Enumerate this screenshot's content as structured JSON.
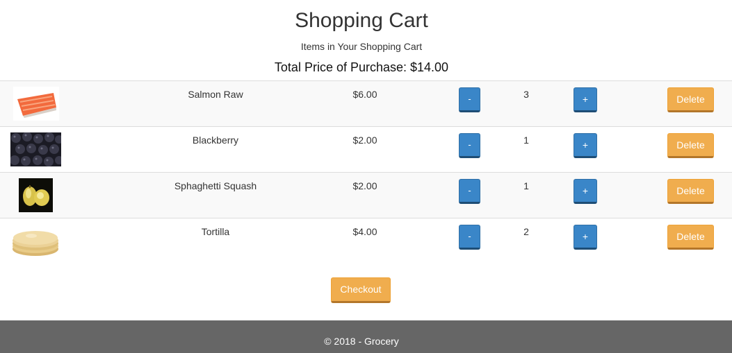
{
  "header": {
    "title": "Shopping Cart",
    "subtitle": "Items in Your Shopping Cart",
    "total_label": "Total Price of Purchase: $14.00"
  },
  "cart": {
    "minus_label": "-",
    "plus_label": "+",
    "delete_label": "Delete",
    "items": [
      {
        "name": "Salmon Raw",
        "price": "$6.00",
        "quantity": "3",
        "image": "salmon-image"
      },
      {
        "name": "Blackberry",
        "price": "$2.00",
        "quantity": "1",
        "image": "blackberry-image"
      },
      {
        "name": "Sphaghetti Squash",
        "price": "$2.00",
        "quantity": "1",
        "image": "squash-image"
      },
      {
        "name": "Tortilla",
        "price": "$4.00",
        "quantity": "2",
        "image": "tortilla-image"
      }
    ]
  },
  "checkout": {
    "label": "Checkout"
  },
  "footer": {
    "text": "© 2018 - Grocery"
  },
  "colors": {
    "primary_button": "#3a86c8",
    "warning_button": "#f0ad4e",
    "footer_background": "#666666",
    "striped_row": "#f9f9f9"
  }
}
